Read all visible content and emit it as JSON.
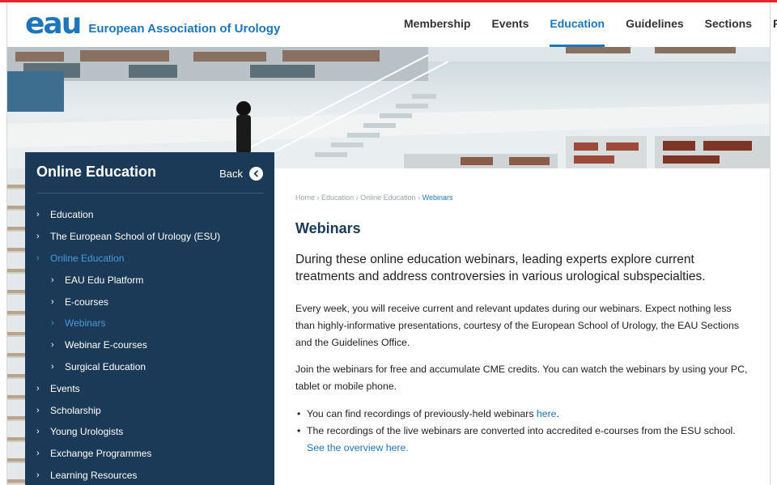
{
  "header": {
    "logo_mark": "eau",
    "logo_text": "European Association of Urology",
    "nav": [
      {
        "label": "Membership"
      },
      {
        "label": "Events"
      },
      {
        "label": "Education",
        "active": true
      },
      {
        "label": "Guidelines"
      },
      {
        "label": "Sections"
      },
      {
        "label": "R"
      }
    ]
  },
  "sidebar": {
    "title": "Online Education",
    "back_label": "Back",
    "back_icon": "chevron-left-circle-icon",
    "items": [
      {
        "label": "Education",
        "level": 0
      },
      {
        "label": "The European School of Urology (ESU)",
        "level": 0
      },
      {
        "label": "Online Education",
        "level": 0,
        "active": true
      },
      {
        "label": "EAU Edu Platform",
        "level": 1
      },
      {
        "label": "E-courses",
        "level": 1
      },
      {
        "label": "Webinars",
        "level": 1,
        "active": true
      },
      {
        "label": "Webinar E-courses",
        "level": 1
      },
      {
        "label": "Surgical Education",
        "level": 1
      },
      {
        "label": "Events",
        "level": 0
      },
      {
        "label": "Scholarship",
        "level": 0
      },
      {
        "label": "Young Urologists",
        "level": 0
      },
      {
        "label": "Exchange Programmes",
        "level": 0
      },
      {
        "label": "Learning Resources",
        "level": 0
      }
    ]
  },
  "breadcrumb": {
    "items": [
      "Home",
      "Education",
      "Online Education"
    ],
    "current": "Webinars",
    "separator": "›"
  },
  "main": {
    "title": "Webinars",
    "lead": "During these online education webinars, leading experts explore current treatments and address controversies in various urological subspecialties.",
    "para1": "Every week, you will receive current and relevant updates during our webinars. Expect nothing less than highly-informative presentations, courtesy of the European School of Urology, the EAU Sections and the Guidelines Office.",
    "para2": "Join the webinars for free and accumulate CME credits. You can watch the webinars by using your PC, tablet or mobile phone.",
    "bullet1_text": "You can find recordings of previously-held webinars ",
    "bullet1_link": "here",
    "bullet1_after": ".",
    "bullet2_text": "The recordings of the live webinars are converted into accredited e-courses from the ESU school. ",
    "bullet2_link": "See the overview here."
  },
  "colors": {
    "brand_blue": "#1d75bb",
    "sidebar_bg": "#1b3a57",
    "top_stripe": "#e0262e",
    "active_link": "#4a9ad8"
  }
}
